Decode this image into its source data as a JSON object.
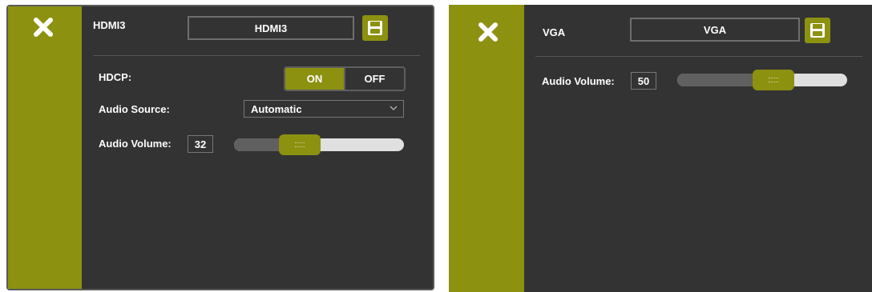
{
  "panels": [
    {
      "title": "HDMI3",
      "name_value": "HDMI3",
      "hdcp_label": "HDCP:",
      "hdcp_on_label": "ON",
      "hdcp_off_label": "OFF",
      "hdcp_state": "ON",
      "audio_source_label": "Audio Source:",
      "audio_source_value": "Automatic",
      "audio_volume_label": "Audio Volume:",
      "audio_volume_value": "32",
      "audio_volume_level": 0.32
    },
    {
      "title": "VGA",
      "name_value": "VGA",
      "audio_volume_label": "Audio Volume:",
      "audio_volume_value": "50",
      "audio_volume_level": 0.5
    }
  ],
  "icons": {
    "close": "close-x-icon",
    "save": "floppy-disk-save-icon",
    "dropdown": "chevron-down-icon"
  },
  "colors": {
    "accent": "#8c9110",
    "panel_bg": "#333333",
    "slider_track": "#e0e0e0",
    "slider_fill": "#606060"
  }
}
